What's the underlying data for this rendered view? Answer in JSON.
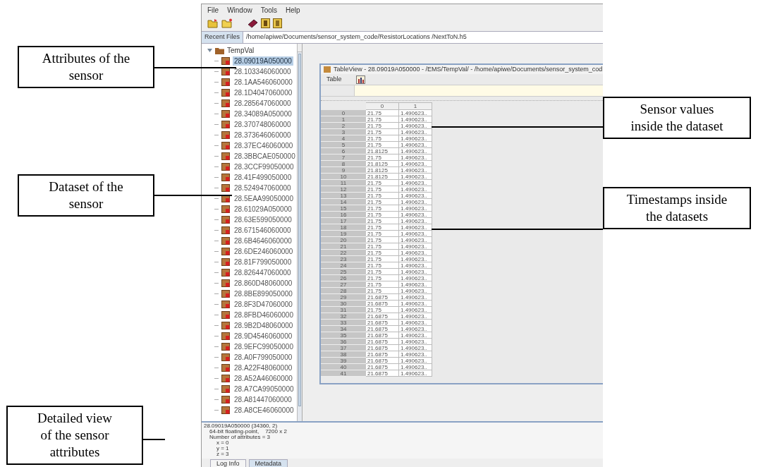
{
  "menu": [
    "File",
    "Window",
    "Tools",
    "Help"
  ],
  "recent_files": {
    "label": "Recent Files",
    "value": "/home/apiwe/Documents/sensor_system_code/ResistorLocations /NextToN.h5"
  },
  "tree": {
    "label": "TempVal",
    "expanded": true,
    "children": [
      {
        "label": "28.09019A050000",
        "selected": true
      },
      {
        "label": "28.103346060000",
        "selected": false
      },
      {
        "label": "28.1AA546060000",
        "selected": false
      },
      {
        "label": "28.1D4047060000",
        "selected": false
      },
      {
        "label": "28.285647060000",
        "selected": false
      },
      {
        "label": "28.34089A050000",
        "selected": false
      },
      {
        "label": "28.370748060000",
        "selected": false
      },
      {
        "label": "28.373646060000",
        "selected": false
      },
      {
        "label": "28.37EC46060000",
        "selected": false
      },
      {
        "label": "28.3BBCAE050000",
        "selected": false
      },
      {
        "label": "28.3CCF99050000",
        "selected": false
      },
      {
        "label": "28.41F499050000",
        "selected": false
      },
      {
        "label": "28.524947060000",
        "selected": false
      },
      {
        "label": "28.5EAA99050000",
        "selected": false
      },
      {
        "label": "28.61029A050000",
        "selected": false
      },
      {
        "label": "28.63E599050000",
        "selected": false
      },
      {
        "label": "28.671546060000",
        "selected": false
      },
      {
        "label": "28.6B4646060000",
        "selected": false
      },
      {
        "label": "28.6DE246060000",
        "selected": false
      },
      {
        "label": "28.81F799050000",
        "selected": false
      },
      {
        "label": "28.826447060000",
        "selected": false
      },
      {
        "label": "28.860D48060000",
        "selected": false
      },
      {
        "label": "28.8BE899050000",
        "selected": false
      },
      {
        "label": "28.8F3D47060000",
        "selected": false
      },
      {
        "label": "28.8FBD46060000",
        "selected": false
      },
      {
        "label": "28.9B2D48060000",
        "selected": false
      },
      {
        "label": "28.9D4546060000",
        "selected": false
      },
      {
        "label": "28.9EFC99050000",
        "selected": false
      },
      {
        "label": "28.A0F799050000",
        "selected": false
      },
      {
        "label": "28.A22F48060000",
        "selected": false
      },
      {
        "label": "28.A52A46060000",
        "selected": false
      },
      {
        "label": "28.A7CA99050000",
        "selected": false
      },
      {
        "label": "28.A81447060000",
        "selected": false
      },
      {
        "label": "28.A8CE46060000",
        "selected": false
      }
    ]
  },
  "table_view": {
    "title": "TableView  -  28.09019A050000  -  /EMS/TempVal/  -  /home/apiwe/Documents/sensor_system_cod",
    "menu": [
      "Table"
    ],
    "columns": [
      "0",
      "1"
    ],
    "rows": [
      {
        "header": "0",
        "cells": [
          "21.75",
          "1.490623.."
        ]
      },
      {
        "header": "1",
        "cells": [
          "21.75",
          "1.490623.."
        ]
      },
      {
        "header": "2",
        "cells": [
          "21.75",
          "1.490623.."
        ]
      },
      {
        "header": "3",
        "cells": [
          "21.75",
          "1.490623.."
        ]
      },
      {
        "header": "4",
        "cells": [
          "21.75",
          "1.490623.."
        ]
      },
      {
        "header": "5",
        "cells": [
          "21.75",
          "1.490623.."
        ]
      },
      {
        "header": "6",
        "cells": [
          "21.8125",
          "1.490623.."
        ]
      },
      {
        "header": "7",
        "cells": [
          "21.75",
          "1.490623.."
        ]
      },
      {
        "header": "8",
        "cells": [
          "21.8125",
          "1.490623.."
        ]
      },
      {
        "header": "9",
        "cells": [
          "21.8125",
          "1.490623.."
        ]
      },
      {
        "header": "10",
        "cells": [
          "21.8125",
          "1.490623.."
        ]
      },
      {
        "header": "11",
        "cells": [
          "21.75",
          "1.490623.."
        ]
      },
      {
        "header": "12",
        "cells": [
          "21.75",
          "1.490623.."
        ]
      },
      {
        "header": "13",
        "cells": [
          "21.75",
          "1.490623.."
        ]
      },
      {
        "header": "14",
        "cells": [
          "21.75",
          "1.490623.."
        ]
      },
      {
        "header": "15",
        "cells": [
          "21.75",
          "1.490623.."
        ]
      },
      {
        "header": "16",
        "cells": [
          "21.75",
          "1.490623.."
        ]
      },
      {
        "header": "17",
        "cells": [
          "21.75",
          "1.490623.."
        ]
      },
      {
        "header": "18",
        "cells": [
          "21.75",
          "1.490623.."
        ]
      },
      {
        "header": "19",
        "cells": [
          "21.75",
          "1.490623.."
        ]
      },
      {
        "header": "20",
        "cells": [
          "21.75",
          "1.490623.."
        ]
      },
      {
        "header": "21",
        "cells": [
          "21.75",
          "1.490623.."
        ]
      },
      {
        "header": "22",
        "cells": [
          "21.75",
          "1.490623.."
        ]
      },
      {
        "header": "23",
        "cells": [
          "21.75",
          "1.490623.."
        ]
      },
      {
        "header": "24",
        "cells": [
          "21.75",
          "1.490623.."
        ]
      },
      {
        "header": "25",
        "cells": [
          "21.75",
          "1.490623.."
        ]
      },
      {
        "header": "26",
        "cells": [
          "21.75",
          "1.490623.."
        ]
      },
      {
        "header": "27",
        "cells": [
          "21.75",
          "1.490623.."
        ]
      },
      {
        "header": "28",
        "cells": [
          "21.75",
          "1.490623.."
        ]
      },
      {
        "header": "29",
        "cells": [
          "21.6875",
          "1.490623.."
        ]
      },
      {
        "header": "30",
        "cells": [
          "21.6875",
          "1.490623.."
        ]
      },
      {
        "header": "31",
        "cells": [
          "21.75",
          "1.490623.."
        ]
      },
      {
        "header": "32",
        "cells": [
          "21.6875",
          "1.490623.."
        ]
      },
      {
        "header": "33",
        "cells": [
          "21.6875",
          "1.490623.."
        ]
      },
      {
        "header": "34",
        "cells": [
          "21.6875",
          "1.490623.."
        ]
      },
      {
        "header": "35",
        "cells": [
          "21.6875",
          "1.490623.."
        ]
      },
      {
        "header": "36",
        "cells": [
          "21.6875",
          "1.490623.."
        ]
      },
      {
        "header": "37",
        "cells": [
          "21.6875",
          "1.490623.."
        ]
      },
      {
        "header": "38",
        "cells": [
          "21.6875",
          "1.490623.."
        ]
      },
      {
        "header": "39",
        "cells": [
          "21.6875",
          "1.490623.."
        ]
      },
      {
        "header": "40",
        "cells": [
          "21.6875",
          "1.490623.."
        ]
      },
      {
        "header": "41",
        "cells": [
          "21.6875",
          "1.490623.."
        ]
      }
    ]
  },
  "info_panel": {
    "lines": [
      "28.09019A050000 (34360, 2)",
      "64-bit floating-point,    7200 x 2",
      "Number of attributes = 3"
    ],
    "attributes": [
      "x = 0",
      "y = 1",
      "z = 3"
    ]
  },
  "bottom_tabs": [
    {
      "label": "Log Info",
      "selected": false
    },
    {
      "label": "Metadata",
      "selected": true
    }
  ],
  "left_callouts": [
    "Attributes of the sensor",
    "Dataset of the sensor",
    "Detailed view of the sensor attributes"
  ],
  "right_callouts": [
    "Sensor values inside the dataset",
    "Timestamps inside the datasets"
  ]
}
